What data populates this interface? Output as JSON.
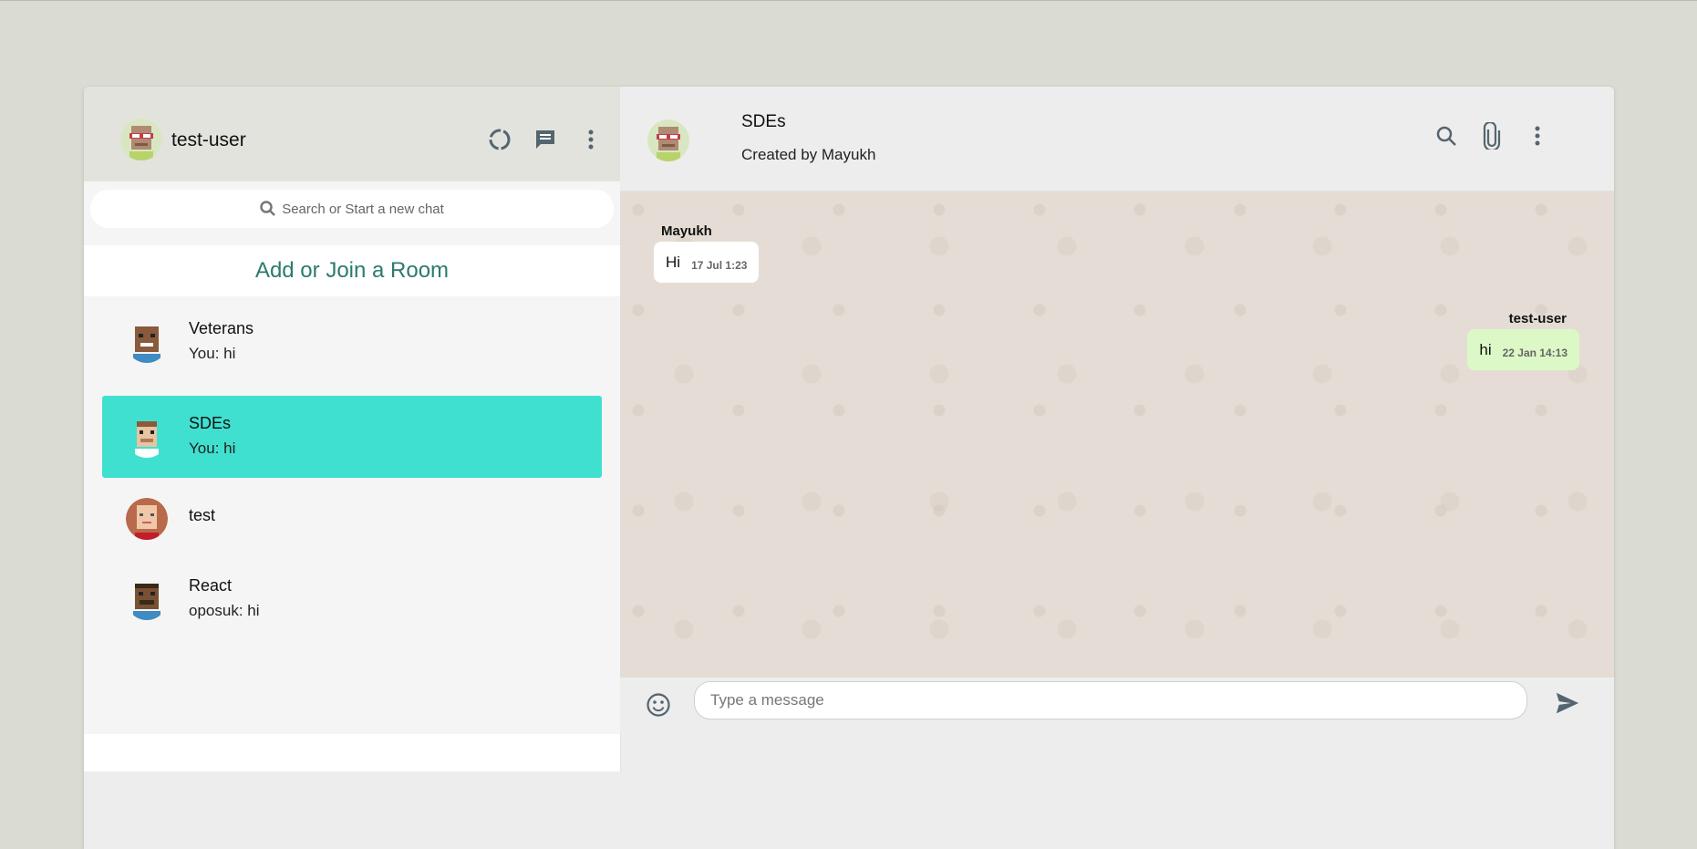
{
  "sidebar": {
    "username": "test-user",
    "search_placeholder": "Search or Start a new chat",
    "add_room": "Add or Join a Room",
    "chats": [
      {
        "name": "Veterans",
        "last": "You: hi",
        "active": false
      },
      {
        "name": "SDEs",
        "last": "You: hi",
        "active": true
      },
      {
        "name": "test",
        "last": "",
        "active": false
      },
      {
        "name": "React",
        "last": "oposuk: hi",
        "active": false
      }
    ],
    "icons": [
      "status-icon",
      "new-chat-icon",
      "more-vert-icon"
    ]
  },
  "chat": {
    "title": "SDEs",
    "subtitle": "Created by Mayukh",
    "icons": [
      "search-icon",
      "attach-icon",
      "more-vert-icon"
    ],
    "messages": [
      {
        "sender": "Mayukh",
        "text": "Hi",
        "time": "17 Jul 1:23",
        "sent": false
      },
      {
        "sender": "test-user",
        "text": "hi",
        "time": "22 Jan 14:13",
        "sent": true
      }
    ],
    "input_placeholder": "Type a message"
  },
  "colors": {
    "active_chat": "#40e0d0",
    "add_room_text": "#2b7a6f",
    "sent_bubble": "#dcf8c6",
    "chat_bg": "#e5ddd5"
  }
}
